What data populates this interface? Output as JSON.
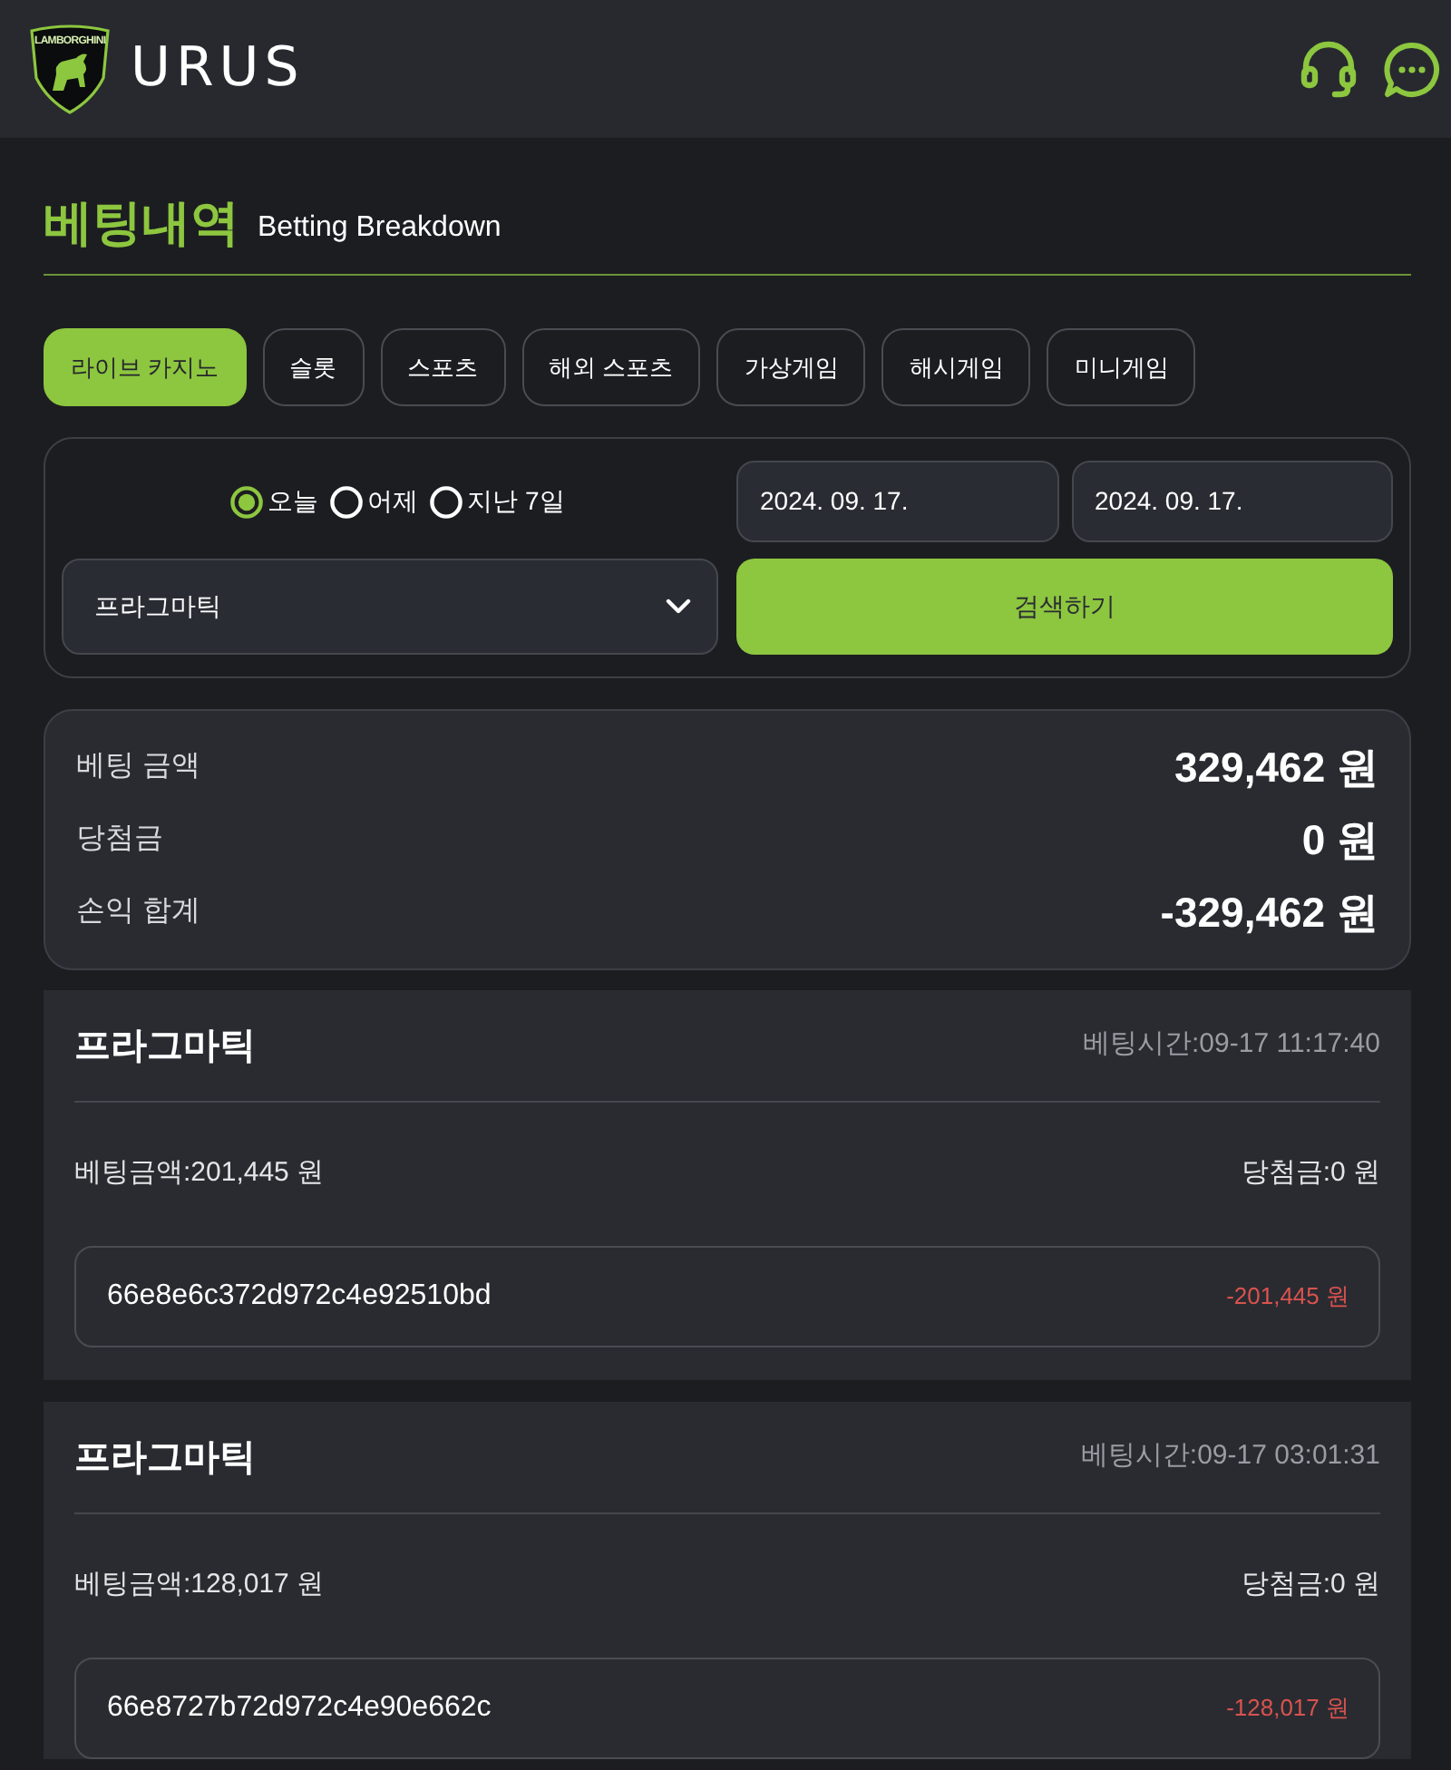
{
  "header": {
    "logo_badge_text": "LAMBORGHINI",
    "brand": "URUS"
  },
  "page_title": {
    "title": "베팅내역",
    "subtitle": "Betting Breakdown"
  },
  "tabs": [
    {
      "label": "라이브 카지노",
      "selected": true
    },
    {
      "label": "슬롯",
      "selected": false
    },
    {
      "label": "스포츠",
      "selected": false
    },
    {
      "label": "해외 스포츠",
      "selected": false
    },
    {
      "label": "가상게임",
      "selected": false
    },
    {
      "label": "해시게임",
      "selected": false
    },
    {
      "label": "미니게임",
      "selected": false
    }
  ],
  "filter": {
    "periods": [
      {
        "label": "오늘",
        "selected": true
      },
      {
        "label": "어제",
        "selected": false
      },
      {
        "label": "지난 7일",
        "selected": false
      }
    ],
    "date_from": "2024. 09. 17.",
    "date_to": "2024. 09. 17.",
    "provider_select": "프라그마틱",
    "search_button": "검색하기"
  },
  "summary": [
    {
      "label": "베팅 금액",
      "value": "329,462 원"
    },
    {
      "label": "당첨금",
      "value": "0 원"
    },
    {
      "label": "손익 합계",
      "value": "-329,462 원"
    }
  ],
  "bets": [
    {
      "provider": "프라그마틱",
      "time": "베팅시간:09-17 11:17:40",
      "bet_amount": "베팅금액:201,445 원",
      "win_amount": "당첨금:0 원",
      "bet_id": "66e8e6c372d972c4e92510bd",
      "result": "-201,445 원",
      "kind": "loss"
    },
    {
      "provider": "프라그마틱",
      "time": "베팅시간:09-17 03:01:31",
      "bet_amount": "베팅금액:128,017 원",
      "win_amount": "당첨금:0 원",
      "bet_id": "66e8727b72d972c4e90e662c",
      "result": "-128,017 원",
      "kind": "loss"
    }
  ]
}
